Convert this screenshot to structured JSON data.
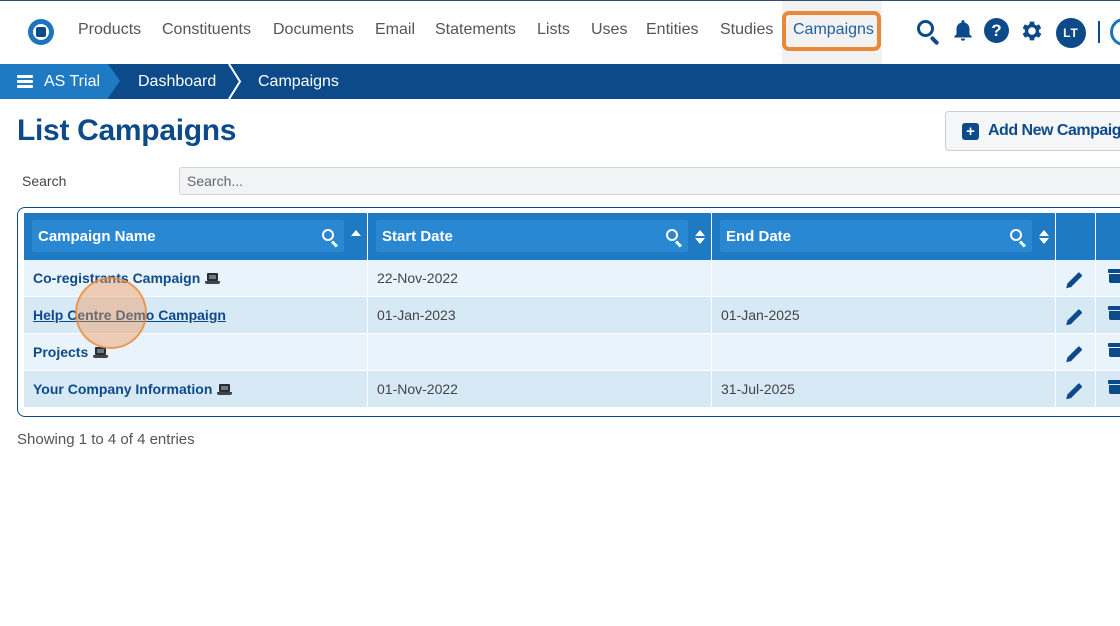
{
  "nav": {
    "items": [
      "Products",
      "Constituents",
      "Documents",
      "Email",
      "Statements",
      "Lists",
      "Uses",
      "Entities",
      "Studies",
      "Campaigns"
    ],
    "active": "Campaigns",
    "avatar_initials": "LT",
    "icons": [
      "logo-icon",
      "search-icon",
      "bell-icon",
      "help-icon",
      "gear-icon"
    ]
  },
  "breadcrumb": {
    "items": [
      "AS Trial",
      "Dashboard",
      "Campaigns"
    ]
  },
  "page": {
    "title": "List Campaigns",
    "add_button_label": "Add New Campaign"
  },
  "search": {
    "label": "Search",
    "placeholder": "Search..."
  },
  "table": {
    "columns": [
      "Campaign Name",
      "Start Date",
      "End Date"
    ],
    "rows": [
      {
        "name": "Co-registrants Campaign",
        "start": "22-Nov-2022",
        "end": "",
        "has_laptop": true
      },
      {
        "name": "Help Centre Demo Campaign",
        "start": "01-Jan-2023",
        "end": "01-Jan-2025",
        "has_laptop": false
      },
      {
        "name": "Projects",
        "start": "",
        "end": "",
        "has_laptop": true
      },
      {
        "name": "Your Company Information",
        "start": "01-Nov-2022",
        "end": "31-Jul-2025",
        "has_laptop": true
      }
    ]
  },
  "footer": {
    "entries_text": "Showing 1 to 4 of 4 entries"
  },
  "colors": {
    "primary": "#0d4a8a",
    "header_blue": "#1f7ac4",
    "highlight_orange": "#e8893a",
    "row_light": "#e9f3fb",
    "row_dark": "#d8e9f6"
  }
}
